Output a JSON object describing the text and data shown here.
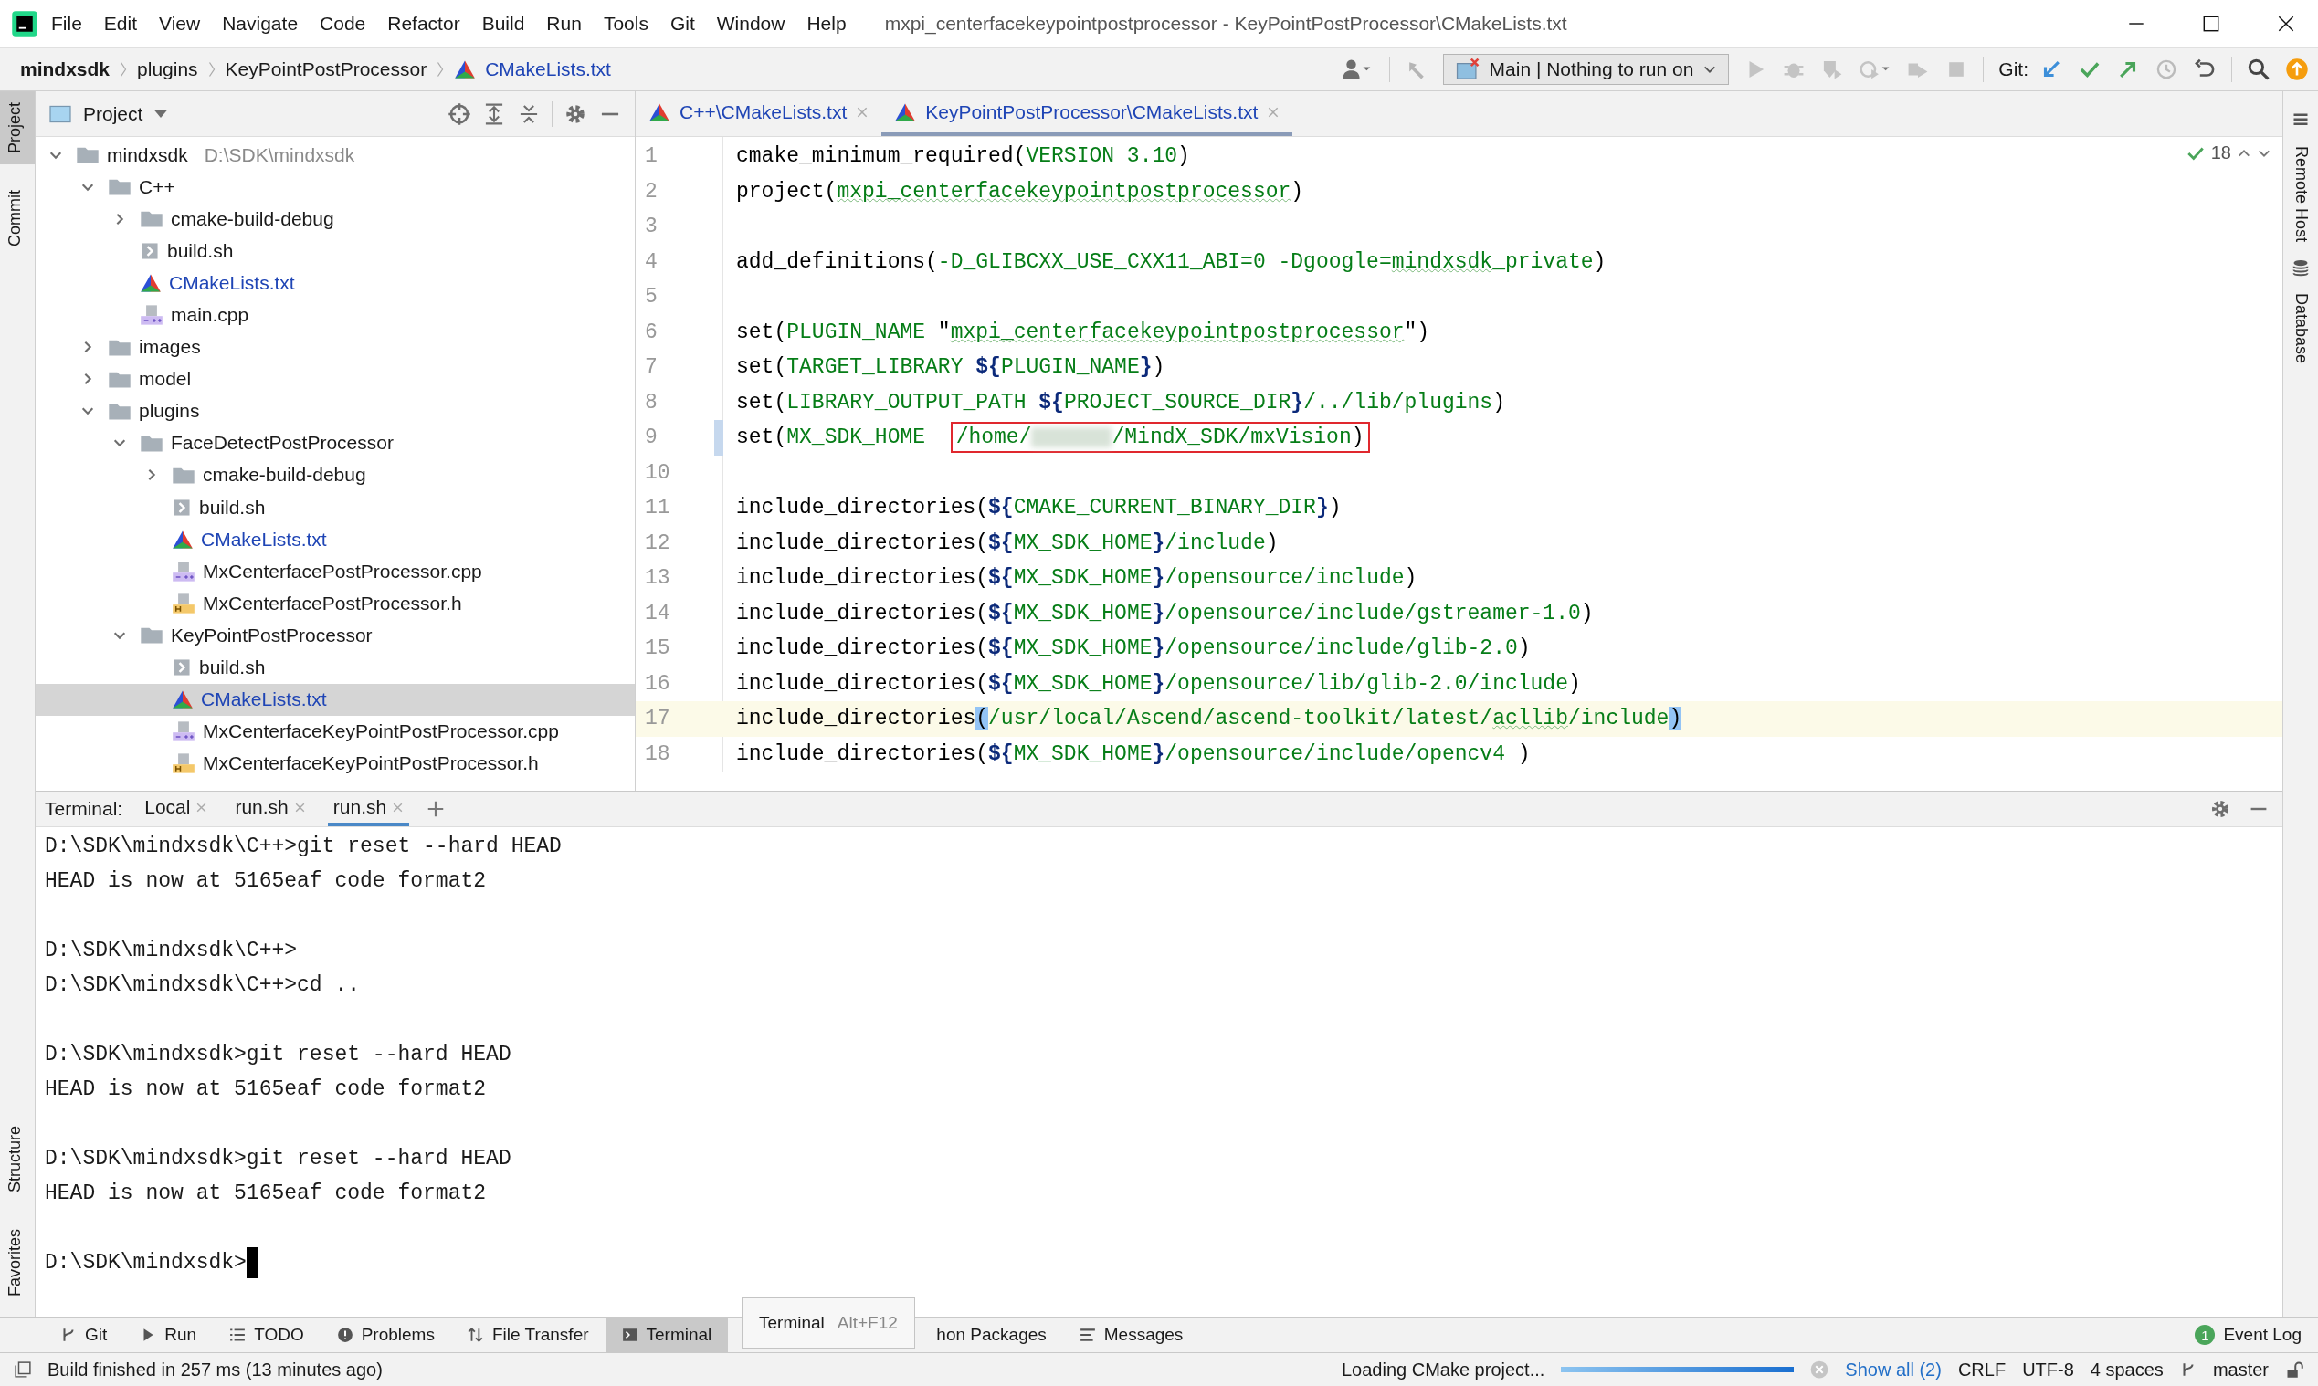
{
  "window": {
    "title": "mxpi_centerfacekeypointpostprocessor - KeyPointPostProcessor\\CMakeLists.txt"
  },
  "menu": [
    "File",
    "Edit",
    "View",
    "Navigate",
    "Code",
    "Refactor",
    "Build",
    "Run",
    "Tools",
    "Git",
    "Window",
    "Help"
  ],
  "breadcrumbs": [
    {
      "label": "mindxsdk",
      "kind": "root"
    },
    {
      "label": "plugins",
      "kind": "folder"
    },
    {
      "label": "KeyPointPostProcessor",
      "kind": "folder"
    },
    {
      "label": "CMakeLists.txt",
      "kind": "cmake"
    }
  ],
  "run_config": {
    "label": "Main | Nothing to run on"
  },
  "git_label": "Git:",
  "left_stripe_top": [
    {
      "label": "Project",
      "selected": true
    },
    {
      "label": "Commit",
      "selected": false
    }
  ],
  "left_stripe_bottom": [
    {
      "label": "Structure",
      "selected": false
    },
    {
      "label": "Favorites",
      "selected": false
    }
  ],
  "right_stripe": [
    {
      "label": "Remote Host",
      "selected": false
    },
    {
      "label": "Database",
      "selected": false
    }
  ],
  "project_panel": {
    "title": "Project",
    "tree": [
      {
        "label": "mindxsdk",
        "hint": "D:\\SDK\\mindxsdk",
        "kind": "folder",
        "expanded": true,
        "selected": false,
        "changed": false,
        "children": [
          {
            "label": "C++",
            "kind": "folder",
            "expanded": true,
            "selected": false,
            "changed": false,
            "children": [
              {
                "label": "cmake-build-debug",
                "kind": "folder",
                "expanded": false,
                "selected": false,
                "changed": false
              },
              {
                "label": "build.sh",
                "kind": "sh",
                "selected": false,
                "changed": false
              },
              {
                "label": "CMakeLists.txt",
                "kind": "cmake",
                "selected": false,
                "changed": true
              },
              {
                "label": "main.cpp",
                "kind": "cpp",
                "selected": false,
                "changed": false
              }
            ]
          },
          {
            "label": "images",
            "kind": "folder",
            "expanded": false,
            "selected": false,
            "changed": false
          },
          {
            "label": "model",
            "kind": "folder",
            "expanded": false,
            "selected": false,
            "changed": false
          },
          {
            "label": "plugins",
            "kind": "folder",
            "expanded": true,
            "selected": false,
            "changed": false,
            "children": [
              {
                "label": "FaceDetectPostProcessor",
                "kind": "folder",
                "expanded": true,
                "selected": false,
                "changed": false,
                "children": [
                  {
                    "label": "cmake-build-debug",
                    "kind": "folder",
                    "expanded": false,
                    "selected": false,
                    "changed": false
                  },
                  {
                    "label": "build.sh",
                    "kind": "sh",
                    "selected": false,
                    "changed": false
                  },
                  {
                    "label": "CMakeLists.txt",
                    "kind": "cmake",
                    "selected": false,
                    "changed": true
                  },
                  {
                    "label": "MxCenterfacePostProcessor.cpp",
                    "kind": "cpp",
                    "selected": false,
                    "changed": false
                  },
                  {
                    "label": "MxCenterfacePostProcessor.h",
                    "kind": "h",
                    "selected": false,
                    "changed": false
                  }
                ]
              },
              {
                "label": "KeyPointPostProcessor",
                "kind": "folder",
                "expanded": true,
                "selected": false,
                "changed": false,
                "children": [
                  {
                    "label": "build.sh",
                    "kind": "sh",
                    "selected": false,
                    "changed": false
                  },
                  {
                    "label": "CMakeLists.txt",
                    "kind": "cmake",
                    "selected": true,
                    "changed": true
                  },
                  {
                    "label": "MxCenterfaceKeyPointPostProcessor.cpp",
                    "kind": "cpp",
                    "selected": false,
                    "changed": false
                  },
                  {
                    "label": "MxCenterfaceKeyPointPostProcessor.h",
                    "kind": "h",
                    "selected": false,
                    "changed": false
                  }
                ]
              }
            ]
          }
        ]
      }
    ]
  },
  "editor": {
    "tabs": [
      {
        "label": "C++\\CMakeLists.txt",
        "selected": false
      },
      {
        "label": "KeyPointPostProcessor\\CMakeLists.txt",
        "selected": true
      }
    ],
    "inspection_count": "18",
    "lines": [
      {
        "number": "1",
        "current": false,
        "changed": false,
        "tokens": [
          {
            "text": "cmake_minimum_required(",
            "kind": "plain"
          },
          {
            "text": "VERSION 3.10",
            "kind": "arg"
          },
          {
            "text": ")",
            "kind": "plain"
          }
        ]
      },
      {
        "number": "2",
        "current": false,
        "changed": false,
        "tokens": [
          {
            "text": "project(",
            "kind": "plain"
          },
          {
            "text": "mxpi_centerfacekeypointpostprocessor",
            "kind": "typo"
          },
          {
            "text": ")",
            "kind": "plain"
          }
        ]
      },
      {
        "number": "3",
        "current": false,
        "changed": false
      },
      {
        "number": "4",
        "current": false,
        "changed": false,
        "tokens": [
          {
            "text": "add_definitions(",
            "kind": "plain"
          },
          {
            "text": "-D_GLIBCXX_USE_CXX11_ABI=0 -Dgoogle=",
            "kind": "arg"
          },
          {
            "text": "mindxsdk",
            "kind": "typo"
          },
          {
            "text": "_private",
            "kind": "arg"
          },
          {
            "text": ")",
            "kind": "plain"
          }
        ]
      },
      {
        "number": "5",
        "current": false,
        "changed": false
      },
      {
        "number": "6",
        "current": false,
        "changed": false,
        "tokens": [
          {
            "text": "set(",
            "kind": "plain"
          },
          {
            "text": "PLUGIN_NAME ",
            "kind": "arg"
          },
          {
            "text": "\"",
            "kind": "plain"
          },
          {
            "text": "mxpi_centerfacekeypointpostprocessor",
            "kind": "typo"
          },
          {
            "text": "\")",
            "kind": "plain"
          }
        ]
      },
      {
        "number": "7",
        "current": false,
        "changed": false,
        "tokens": [
          {
            "text": "set(",
            "kind": "plain"
          },
          {
            "text": "TARGET_LIBRARY ",
            "kind": "arg"
          },
          {
            "text": "${",
            "kind": "brace"
          },
          {
            "text": "PLUGIN_NAME",
            "kind": "arg"
          },
          {
            "text": "}",
            "kind": "brace"
          },
          {
            "text": ")",
            "kind": "plain"
          }
        ]
      },
      {
        "number": "8",
        "current": false,
        "changed": false,
        "tokens": [
          {
            "text": "set(",
            "kind": "plain"
          },
          {
            "text": "LIBRARY_OUTPUT_PATH ",
            "kind": "arg"
          },
          {
            "text": "${",
            "kind": "brace"
          },
          {
            "text": "PROJECT_SOURCE_DIR",
            "kind": "arg"
          },
          {
            "text": "}",
            "kind": "brace"
          },
          {
            "text": "/../lib/plugins",
            "kind": "arg"
          },
          {
            "text": ")",
            "kind": "plain"
          }
        ]
      },
      {
        "number": "9",
        "current": false,
        "changed": true,
        "tokens": [
          {
            "text": "set(",
            "kind": "plain"
          },
          {
            "text": "MX_SDK_HOME  ",
            "kind": "arg"
          },
          {
            "kind": "boxed",
            "parts": [
              {
                "text": "/home/",
                "kind": "arg"
              },
              {
                "kind": "redacted"
              },
              {
                "text": "/MindX_SDK/mxVision",
                "kind": "arg"
              },
              {
                "text": ")",
                "kind": "plain"
              }
            ]
          }
        ]
      },
      {
        "number": "10",
        "current": false,
        "changed": false
      },
      {
        "number": "11",
        "current": false,
        "changed": false,
        "tokens": [
          {
            "text": "include_directories(",
            "kind": "plain"
          },
          {
            "text": "${",
            "kind": "brace"
          },
          {
            "text": "CMAKE_CURRENT_BINARY_DIR",
            "kind": "arg"
          },
          {
            "text": "}",
            "kind": "brace"
          },
          {
            "text": ")",
            "kind": "plain"
          }
        ]
      },
      {
        "number": "12",
        "current": false,
        "changed": false,
        "tokens": [
          {
            "text": "include_directories(",
            "kind": "plain"
          },
          {
            "text": "${",
            "kind": "brace"
          },
          {
            "text": "MX_SDK_HOME",
            "kind": "arg"
          },
          {
            "text": "}",
            "kind": "brace"
          },
          {
            "text": "/include",
            "kind": "arg"
          },
          {
            "text": ")",
            "kind": "plain"
          }
        ]
      },
      {
        "number": "13",
        "current": false,
        "changed": false,
        "tokens": [
          {
            "text": "include_directories(",
            "kind": "plain"
          },
          {
            "text": "${",
            "kind": "brace"
          },
          {
            "text": "MX_SDK_HOME",
            "kind": "arg"
          },
          {
            "text": "}",
            "kind": "brace"
          },
          {
            "text": "/opensource/include",
            "kind": "arg"
          },
          {
            "text": ")",
            "kind": "plain"
          }
        ]
      },
      {
        "number": "14",
        "current": false,
        "changed": false,
        "tokens": [
          {
            "text": "include_directories(",
            "kind": "plain"
          },
          {
            "text": "${",
            "kind": "brace"
          },
          {
            "text": "MX_SDK_HOME",
            "kind": "arg"
          },
          {
            "text": "}",
            "kind": "brace"
          },
          {
            "text": "/opensource/include/gstreamer-1.0",
            "kind": "arg"
          },
          {
            "text": ")",
            "kind": "plain"
          }
        ]
      },
      {
        "number": "15",
        "current": false,
        "changed": false,
        "tokens": [
          {
            "text": "include_directories(",
            "kind": "plain"
          },
          {
            "text": "${",
            "kind": "brace"
          },
          {
            "text": "MX_SDK_HOME",
            "kind": "arg"
          },
          {
            "text": "}",
            "kind": "brace"
          },
          {
            "text": "/opensource/include/glib-2.0",
            "kind": "arg"
          },
          {
            "text": ")",
            "kind": "plain"
          }
        ]
      },
      {
        "number": "16",
        "current": false,
        "changed": false,
        "tokens": [
          {
            "text": "include_directories(",
            "kind": "plain"
          },
          {
            "text": "${",
            "kind": "brace"
          },
          {
            "text": "MX_SDK_HOME",
            "kind": "arg"
          },
          {
            "text": "}",
            "kind": "brace"
          },
          {
            "text": "/opensource/lib/glib-2.0/include",
            "kind": "arg"
          },
          {
            "text": ")",
            "kind": "plain"
          }
        ]
      },
      {
        "number": "17",
        "current": true,
        "changed": false,
        "tokens": [
          {
            "text": "include_directories",
            "kind": "plain"
          },
          {
            "text": "(",
            "kind": "match"
          },
          {
            "text": "/usr/local/Ascend/ascend-toolkit/latest/",
            "kind": "arg"
          },
          {
            "text": "acllib",
            "kind": "typo"
          },
          {
            "text": "/include",
            "kind": "arg"
          },
          {
            "text": ")",
            "kind": "match"
          }
        ]
      },
      {
        "number": "18",
        "current": false,
        "changed": false,
        "tokens": [
          {
            "text": "include_directories(",
            "kind": "plain"
          },
          {
            "text": "${",
            "kind": "brace"
          },
          {
            "text": "MX_SDK_HOME",
            "kind": "arg"
          },
          {
            "text": "}",
            "kind": "brace"
          },
          {
            "text": "/opensource/include/opencv4 ",
            "kind": "arg"
          },
          {
            "text": ")",
            "kind": "plain"
          }
        ]
      }
    ]
  },
  "terminal": {
    "title": "Terminal:",
    "tabs": [
      {
        "label": "Local",
        "selected": false
      },
      {
        "label": "run.sh",
        "selected": false
      },
      {
        "label": "run.sh",
        "selected": true
      }
    ],
    "blocks": [
      [
        "D:\\SDK\\mindxsdk\\C++>git reset --hard HEAD",
        "HEAD is now at 5165eaf code format2"
      ],
      [
        "D:\\SDK\\mindxsdk\\C++>",
        "D:\\SDK\\mindxsdk\\C++>cd .."
      ],
      [
        "D:\\SDK\\mindxsdk>git reset --hard HEAD",
        "HEAD is now at 5165eaf code format2"
      ],
      [
        "D:\\SDK\\mindxsdk>git reset --hard HEAD",
        "HEAD is now at 5165eaf code format2"
      ],
      [
        "D:\\SDK\\mindxsdk>"
      ]
    ],
    "cursor": true
  },
  "bottom_tabs": [
    {
      "label": "Git",
      "kind": "git",
      "selected": false
    },
    {
      "label": "Run",
      "kind": "run",
      "selected": false
    },
    {
      "label": "TODO",
      "kind": "todo",
      "selected": false
    },
    {
      "label": "Problems",
      "kind": "problems",
      "selected": false
    },
    {
      "label": "File Transfer",
      "kind": "transfer",
      "selected": false
    },
    {
      "label": "Terminal",
      "kind": "terminal",
      "selected": true
    },
    {
      "label": "hon Packages",
      "kind": "packages",
      "selected": false
    },
    {
      "label": "Messages",
      "kind": "messages",
      "selected": false
    }
  ],
  "event_log": {
    "label": "Event Log",
    "count": "1"
  },
  "tooltip": {
    "label": "Terminal",
    "shortcut": "Alt+F12"
  },
  "status_bar": {
    "message": "Build finished in 257 ms (13 minutes ago)",
    "task": "Loading CMake project...",
    "level": 1,
    "show_all": "Show all (2)",
    "line_separator": "CRLF",
    "encoding": "UTF-8",
    "indent": "4 spaces",
    "branch": "master"
  }
}
